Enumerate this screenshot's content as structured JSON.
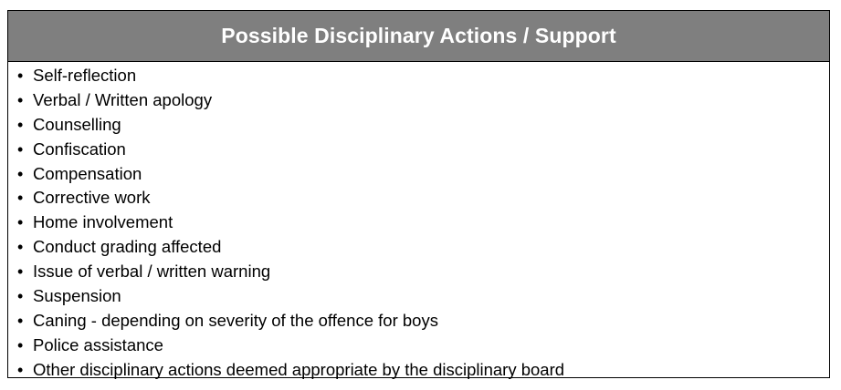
{
  "header": {
    "title": "Possible Disciplinary Actions / Support",
    "background_color": "#7f7f7f",
    "text_color": "#ffffff"
  },
  "bullet_glyph": "•",
  "items": [
    "Self-reflection",
    "Verbal / Written apology",
    "Counselling",
    "Confiscation",
    "Compensation",
    "Corrective work",
    "Home involvement",
    "Conduct grading affected",
    "Issue of verbal / written warning",
    "Suspension",
    "Caning - depending on severity of the offence for boys",
    "Police assistance",
    "Other disciplinary actions deemed appropriate by the disciplinary board"
  ]
}
